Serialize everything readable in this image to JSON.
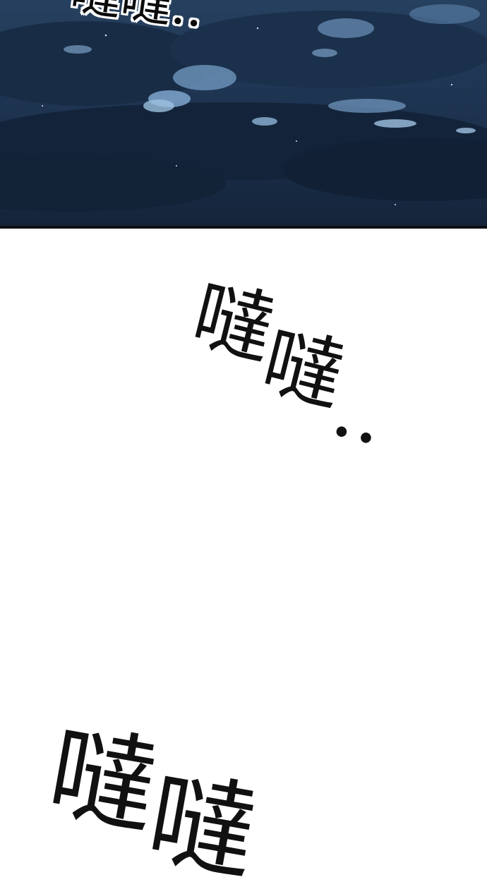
{
  "panels": {
    "top": {
      "sfx_text": "噠噠.."
    },
    "middle": {
      "sfx_chars": [
        "噠",
        "噠",
        ".."
      ]
    },
    "bottom": {
      "sfx_chars": [
        "噠",
        "噠"
      ]
    }
  },
  "colors": {
    "sky": "#1b2f48",
    "cloud_light": "#8fb4d6",
    "ink": "#111111",
    "paper": "#ffffff"
  }
}
